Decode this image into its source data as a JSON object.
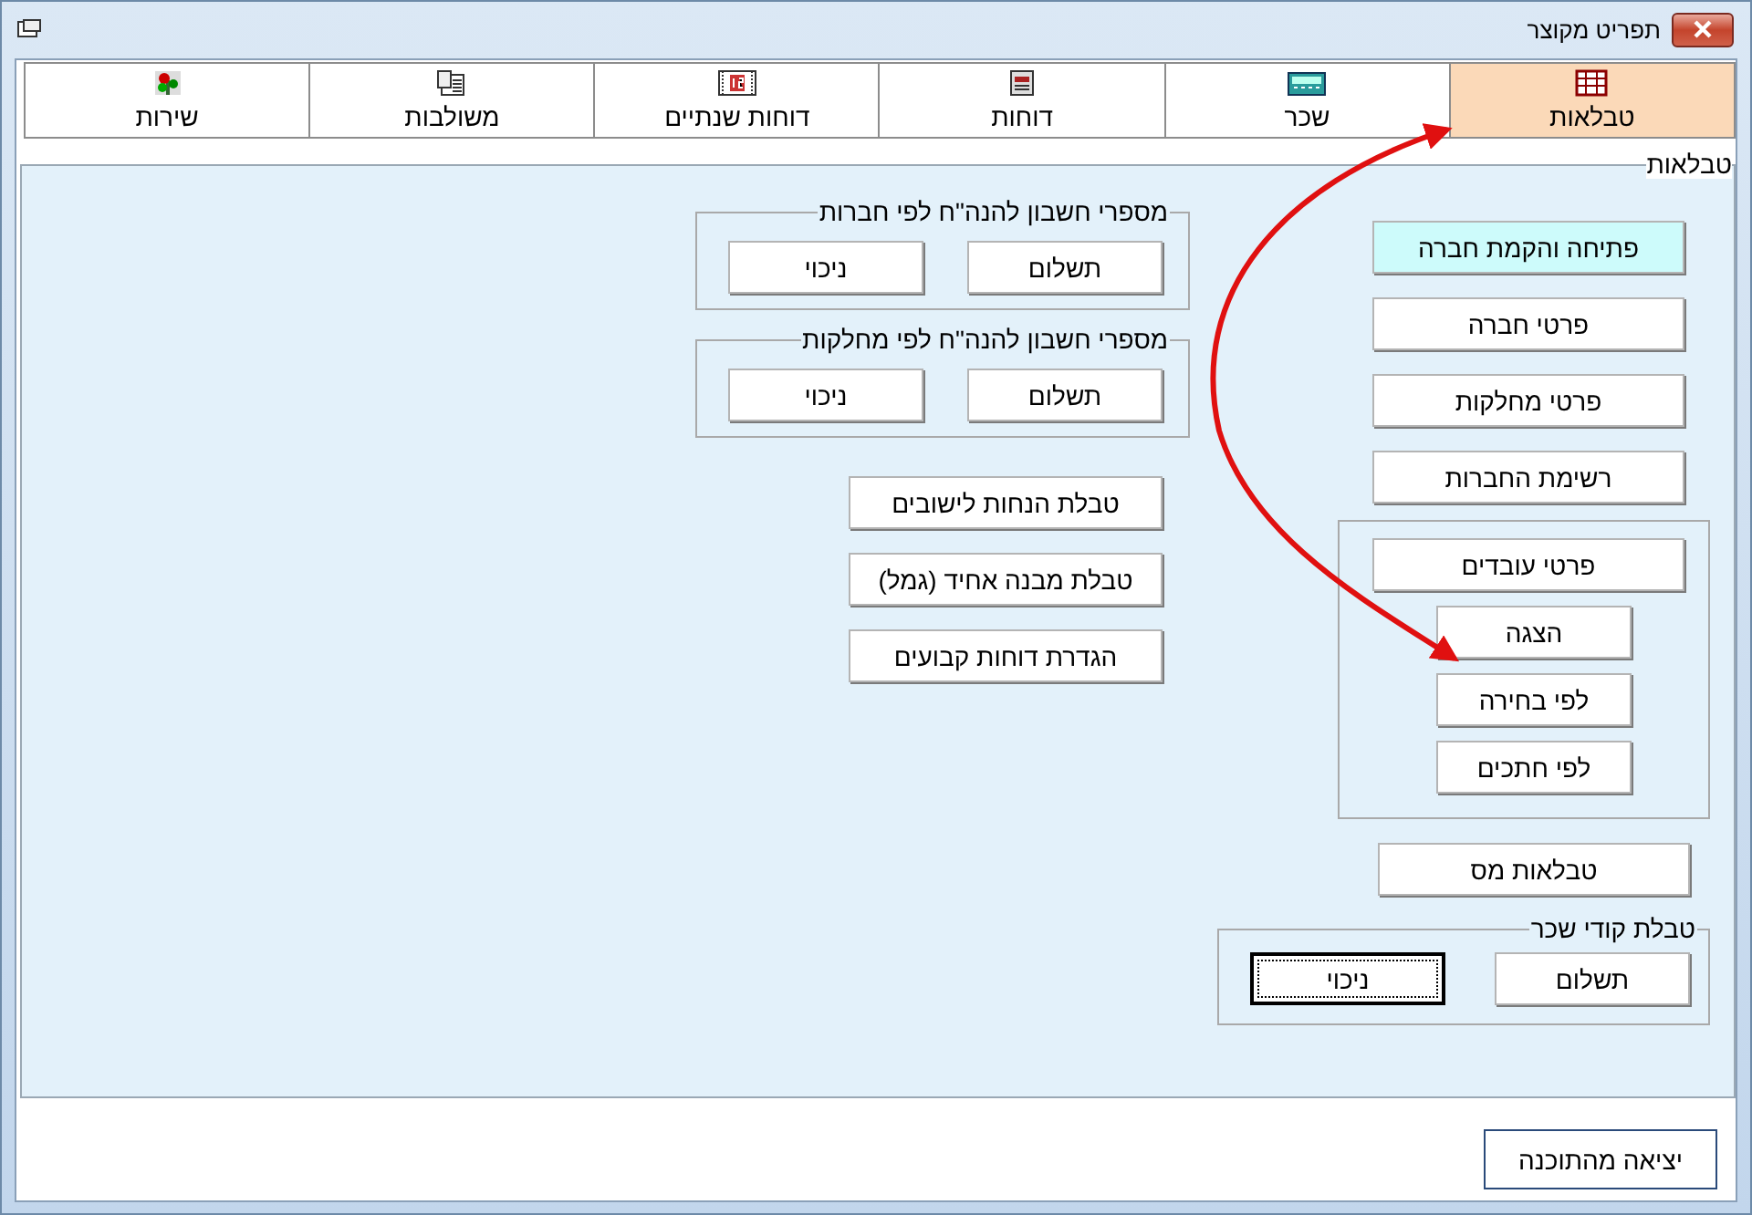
{
  "window": {
    "title": "תפריט מקוצר"
  },
  "tabs": [
    {
      "label": "טבלאות",
      "selected": true
    },
    {
      "label": "שכר",
      "selected": false
    },
    {
      "label": "דוחות",
      "selected": false
    },
    {
      "label": "דוחות שנתיים",
      "selected": false
    },
    {
      "label": "משולבות",
      "selected": false
    },
    {
      "label": "שירות",
      "selected": false
    }
  ],
  "panel": {
    "title": "טבלאות",
    "account_groups": [
      {
        "title": "מספרי חשבון להנה\"ח לפי חברות",
        "buttons": [
          "תשלום",
          "ניכוי"
        ]
      },
      {
        "title": "מספרי חשבון להנה\"ח לפי מחלקות",
        "buttons": [
          "תשלום",
          "ניכוי"
        ]
      }
    ],
    "table_buttons": [
      "טבלת הנחות לישובים",
      "טבלת מבנה אחיד (גמל)",
      "הגדרת דוחות קבועים"
    ],
    "company_buttons": [
      {
        "label": "פתיחה והקמת חברה",
        "highlighted": true
      },
      {
        "label": "פרטי חברה",
        "highlighted": false
      },
      {
        "label": "פרטי מחלקות",
        "highlighted": false
      },
      {
        "label": "רשימת החברות",
        "highlighted": false
      }
    ],
    "employees": {
      "main": "פרטי עובדים",
      "sub": [
        "הצגה",
        "לפי בחירה",
        "לפי חתכים"
      ]
    },
    "tax_button": "טבלאות מס",
    "wage_codes": {
      "title": "טבלת קודי שכר",
      "buttons": [
        {
          "label": "תשלום",
          "focused": false
        },
        {
          "label": "ניכוי",
          "focused": true
        }
      ]
    }
  },
  "exit_button": "יציאה מהתוכנה"
}
